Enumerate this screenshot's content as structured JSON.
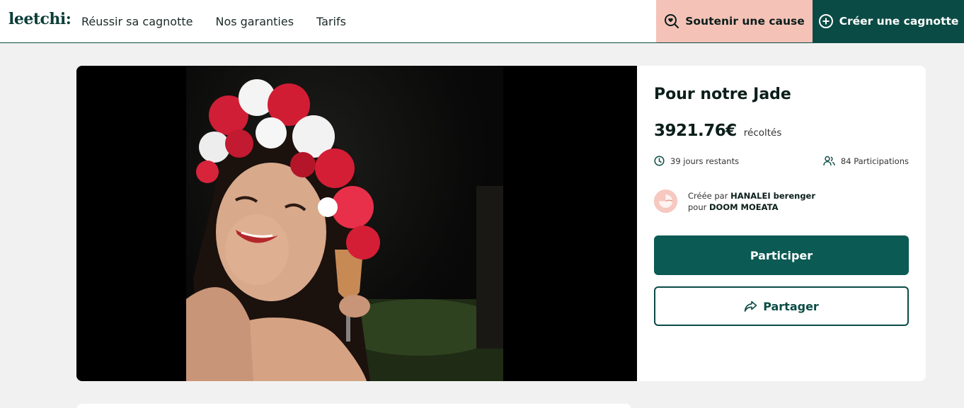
{
  "header": {
    "logo": "leetchi:",
    "nav": [
      "Réussir sa cagnotte",
      "Nos garanties",
      "Tarifs"
    ],
    "support_label": "Soutenir une cause",
    "create_label": "Créer une cagnotte"
  },
  "pot": {
    "title": "Pour notre Jade",
    "amount": "3921.76€",
    "amount_label": "récoltés",
    "days_left": "39 jours restants",
    "participations": "84 Participations",
    "created_by_prefix": "Créée par",
    "creator": "HANALEI berenger",
    "for_prefix": "pour",
    "beneficiary": "DOOM MOEATA",
    "participate_label": "Participer",
    "share_label": "Partager"
  },
  "colors": {
    "primary": "#0b4b45",
    "primary_button": "#0b5a53",
    "support_bg": "#f5c2b8",
    "page_bg": "#f1f1f1"
  },
  "icons": [
    "search-heart-icon",
    "plus-circle-icon",
    "clock-icon",
    "people-icon",
    "share-arrow-icon"
  ]
}
